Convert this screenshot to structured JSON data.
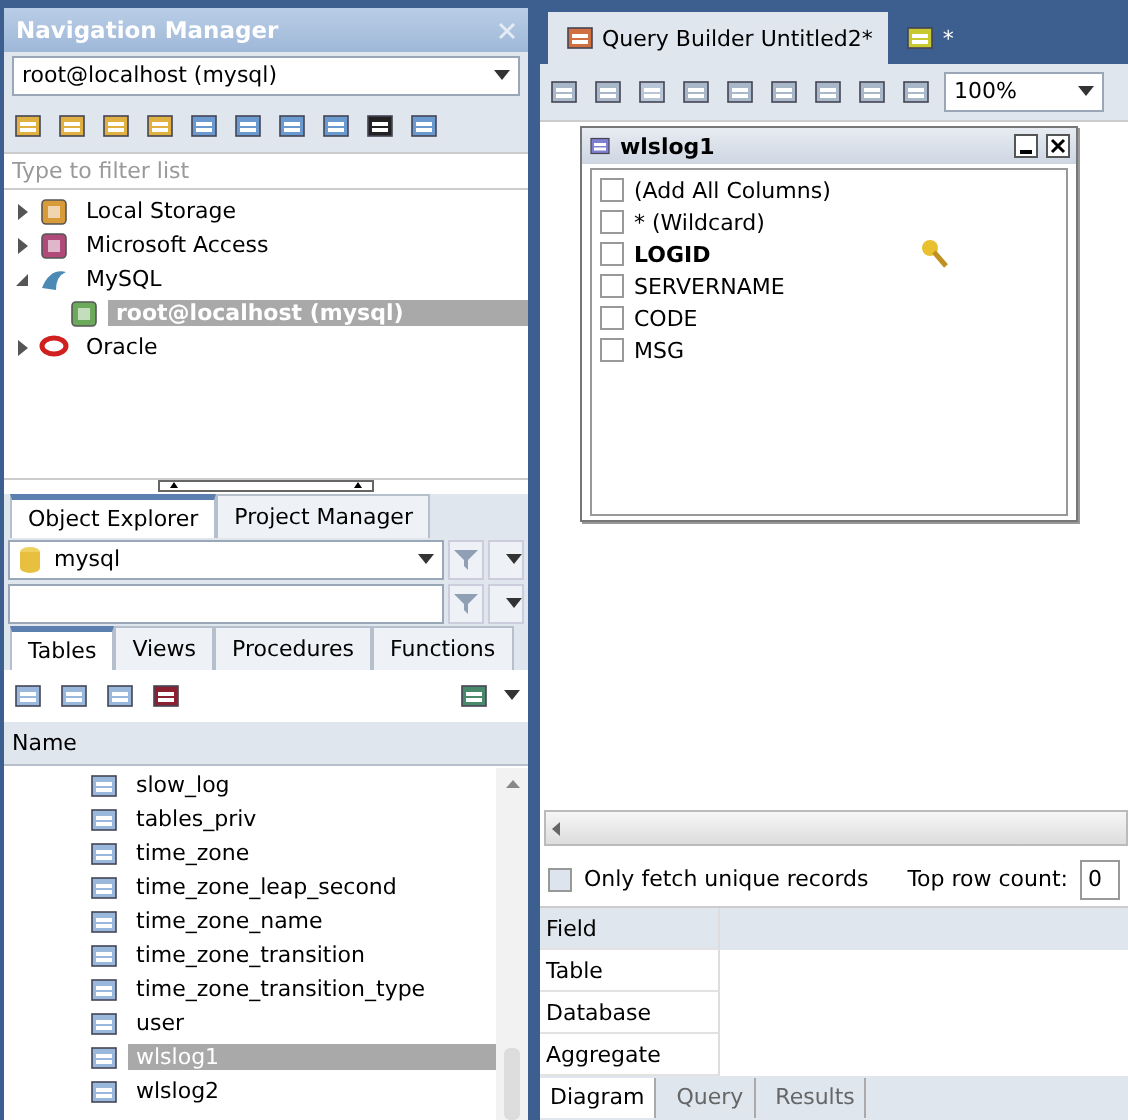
{
  "navigation_manager": {
    "title": "Navigation Manager",
    "connection": "root@localhost (mysql)",
    "filter_placeholder": "Type to filter list",
    "tree": [
      {
        "label": "Local Storage",
        "kind": "storage",
        "expanded": false,
        "selected": false
      },
      {
        "label": "Microsoft Access",
        "kind": "access",
        "expanded": false,
        "selected": false
      },
      {
        "label": "MySQL",
        "kind": "mysql",
        "expanded": true,
        "selected": false,
        "children": [
          {
            "label": "root@localhost (mysql)",
            "kind": "connection",
            "selected": true
          }
        ]
      },
      {
        "label": "Oracle",
        "kind": "oracle",
        "expanded": false,
        "selected": false
      }
    ]
  },
  "explorer_tabs": [
    {
      "label": "Object Explorer",
      "selected": true
    },
    {
      "label": "Project Manager",
      "selected": false
    }
  ],
  "database": "mysql",
  "object_tabs": [
    {
      "label": "Tables",
      "selected": true
    },
    {
      "label": "Views",
      "selected": false
    },
    {
      "label": "Procedures",
      "selected": false
    },
    {
      "label": "Functions",
      "selected": false
    }
  ],
  "tables": {
    "header": "Name",
    "rows": [
      {
        "name": "slow_log",
        "selected": false
      },
      {
        "name": "tables_priv",
        "selected": false
      },
      {
        "name": "time_zone",
        "selected": false
      },
      {
        "name": "time_zone_leap_second",
        "selected": false
      },
      {
        "name": "time_zone_name",
        "selected": false
      },
      {
        "name": "time_zone_transition",
        "selected": false
      },
      {
        "name": "time_zone_transition_type",
        "selected": false
      },
      {
        "name": "user",
        "selected": false
      },
      {
        "name": "wlslog1",
        "selected": true
      },
      {
        "name": "wlslog2",
        "selected": false
      }
    ]
  },
  "document_tabs": [
    {
      "label": "Query Builder Untitled2*",
      "selected": true
    },
    {
      "label": "*",
      "selected": false
    }
  ],
  "zoom": "100%",
  "table_window": {
    "title": "wlslog1",
    "columns": [
      {
        "label": "(Add All Columns)",
        "checked": false,
        "key": false
      },
      {
        "label": "* (Wildcard)",
        "checked": false,
        "key": false
      },
      {
        "label": "LOGID",
        "checked": false,
        "key": true
      },
      {
        "label": "SERVERNAME",
        "checked": false,
        "key": false
      },
      {
        "label": "CODE",
        "checked": false,
        "key": false
      },
      {
        "label": "MSG",
        "checked": false,
        "key": false
      }
    ]
  },
  "options": {
    "unique_label": "Only fetch unique records",
    "unique_checked": false,
    "top_row_label": "Top row count:",
    "top_row_value": "0"
  },
  "grid_rows": [
    {
      "label": "Field",
      "kind": "header"
    },
    {
      "label": "Table",
      "kind": "row"
    },
    {
      "label": "Database",
      "kind": "row"
    },
    {
      "label": "Aggregate",
      "kind": "row"
    }
  ],
  "bottom_tabs": [
    {
      "label": "Diagram",
      "selected": true
    },
    {
      "label": "Query",
      "selected": false
    },
    {
      "label": "Results",
      "selected": false
    }
  ]
}
